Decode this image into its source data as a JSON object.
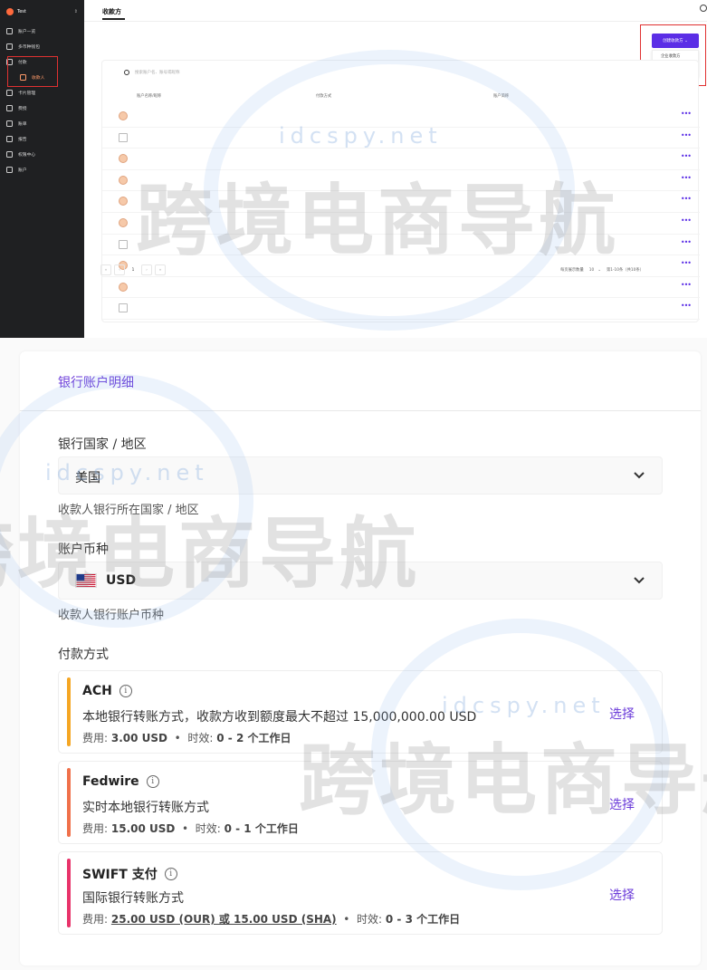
{
  "sidebar": {
    "org": "Test",
    "items": [
      {
        "label": "账户一览"
      },
      {
        "label": "多币种钱包"
      },
      {
        "label": "付款"
      },
      {
        "label": "收款人"
      },
      {
        "label": "卡片管理"
      },
      {
        "label": "费授"
      },
      {
        "label": "账单"
      },
      {
        "label": "报告"
      },
      {
        "label": "权限中心"
      },
      {
        "label": "账户"
      }
    ]
  },
  "main": {
    "title": "收款方",
    "create_button": "创建收款方",
    "dropdown": [
      "企业收款方",
      "个人收款方"
    ],
    "search_placeholder": "搜索账户名、账号或昵称",
    "columns": [
      "账户名称/昵称",
      "付款方式",
      "账户简称"
    ],
    "rows": [
      "person",
      "bank",
      "person",
      "person",
      "person",
      "person",
      "bank",
      "person",
      "person",
      "bank"
    ],
    "pagination": {
      "page": "1",
      "per_page_label": "每页展示数量",
      "per_page": "10",
      "range": "第1-10条（共10条）"
    }
  },
  "detail": {
    "title": "银行账户明细",
    "country_label": "银行国家 / 地区",
    "country_value": "美国",
    "country_hint": "收款人银行所在国家 / 地区",
    "currency_label": "账户币种",
    "currency_value": "USD",
    "currency_hint": "收款人银行账户币种",
    "methods_label": "付款方式",
    "methods": [
      {
        "name": "ACH",
        "desc": "本地银行转账方式，收款方收到额度最大不超过 15,000,000.00 USD",
        "fee_label": "费用:",
        "fee_value": "3.00 USD",
        "time_label": "时效:",
        "time_value": "0 - 2 个工作日",
        "choose": "选择",
        "color": "#f5a623"
      },
      {
        "name": "Fedwire",
        "desc": "实时本地银行转账方式",
        "fee_label": "费用:",
        "fee_value": "15.00 USD",
        "time_label": "时效:",
        "time_value": "0 - 1 个工作日",
        "choose": "选择",
        "color": "#f0704a"
      },
      {
        "name": "SWIFT 支付",
        "desc": "国际银行转账方式",
        "fee_label": "费用:",
        "fee_value": "25.00 USD (OUR) 或 15.00 USD (SHA)",
        "time_label": "时效:",
        "time_value": "0 - 3 个工作日",
        "choose": "选择",
        "color": "#e8336a"
      }
    ]
  },
  "watermark": {
    "domain": "idcspy.net",
    "text": "跨境电商导航"
  }
}
